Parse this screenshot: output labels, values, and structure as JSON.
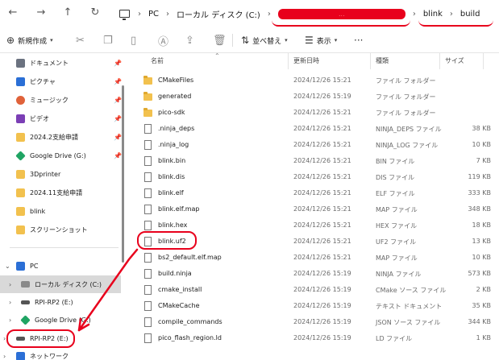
{
  "address_bar": {
    "pc": "PC",
    "drive": "ローカル ディスク (C:)",
    "redacted": "...",
    "blink": "blink",
    "build": "build"
  },
  "toolbar": {
    "new_label": "新規作成",
    "sort_label": "並べ替え",
    "view_label": "表示"
  },
  "sidebar": {
    "quick": [
      {
        "label": "ドキュメント",
        "icon": "document-icon",
        "color": "#6b7280"
      },
      {
        "label": "ピクチャ",
        "icon": "picture-icon",
        "color": "#2b6fd6"
      },
      {
        "label": "ミュージック",
        "icon": "music-icon",
        "color": "#e0623a"
      },
      {
        "label": "ビデオ",
        "icon": "video-icon",
        "color": "#7b3fb5"
      },
      {
        "label": "2024.2支給申請",
        "icon": "folder-icon",
        "color": "#f2c14e"
      },
      {
        "label": "Google Drive (G:)",
        "icon": "google-drive-icon",
        "color": "#1fa463"
      },
      {
        "label": "3Dprinter",
        "icon": "folder-icon",
        "color": "#f2c14e"
      },
      {
        "label": "2024.11支給申請",
        "icon": "folder-icon",
        "color": "#f2c14e"
      },
      {
        "label": "blink",
        "icon": "folder-icon",
        "color": "#f2c14e"
      },
      {
        "label": "スクリーンショット",
        "icon": "folder-icon",
        "color": "#f2c14e"
      }
    ],
    "pc": "PC",
    "drives": [
      {
        "label": "ローカル ディスク (C:)",
        "icon": "windows-drive-icon"
      },
      {
        "label": "RPI-RP2 (E:)",
        "icon": "usb-drive-icon"
      },
      {
        "label": "Google Drive (G:)",
        "icon": "google-drive-icon"
      },
      {
        "label": "RPI-RP2 (E:)",
        "icon": "usb-drive-icon"
      }
    ],
    "network": "ネットワーク"
  },
  "file_list": {
    "columns": {
      "name": "名前",
      "date": "更新日時",
      "type": "種類",
      "size": "サイズ"
    },
    "rows": [
      {
        "name": "CMakeFiles",
        "date": "2024/12/26 15:21",
        "type": "ファイル フォルダー",
        "size": "",
        "kind": "folder"
      },
      {
        "name": "generated",
        "date": "2024/12/26 15:19",
        "type": "ファイル フォルダー",
        "size": "",
        "kind": "folder"
      },
      {
        "name": "pico-sdk",
        "date": "2024/12/26 15:21",
        "type": "ファイル フォルダー",
        "size": "",
        "kind": "folder"
      },
      {
        "name": ".ninja_deps",
        "date": "2024/12/26 15:21",
        "type": "NINJA_DEPS ファイル",
        "size": "38 KB",
        "kind": "file"
      },
      {
        "name": ".ninja_log",
        "date": "2024/12/26 15:21",
        "type": "NINJA_LOG ファイル",
        "size": "10 KB",
        "kind": "file"
      },
      {
        "name": "blink.bin",
        "date": "2024/12/26 15:21",
        "type": "BIN ファイル",
        "size": "7 KB",
        "kind": "file"
      },
      {
        "name": "blink.dis",
        "date": "2024/12/26 15:21",
        "type": "DIS ファイル",
        "size": "119 KB",
        "kind": "file"
      },
      {
        "name": "blink.elf",
        "date": "2024/12/26 15:21",
        "type": "ELF ファイル",
        "size": "333 KB",
        "kind": "file"
      },
      {
        "name": "blink.elf.map",
        "date": "2024/12/26 15:21",
        "type": "MAP ファイル",
        "size": "348 KB",
        "kind": "file"
      },
      {
        "name": "blink.hex",
        "date": "2024/12/26 15:21",
        "type": "HEX ファイル",
        "size": "18 KB",
        "kind": "file"
      },
      {
        "name": "blink.uf2",
        "date": "2024/12/26 15:21",
        "type": "UF2 ファイル",
        "size": "13 KB",
        "kind": "file"
      },
      {
        "name": "bs2_default.elf.map",
        "date": "2024/12/26 15:21",
        "type": "MAP ファイル",
        "size": "10 KB",
        "kind": "file"
      },
      {
        "name": "build.ninja",
        "date": "2024/12/26 15:19",
        "type": "NINJA ファイル",
        "size": "573 KB",
        "kind": "file"
      },
      {
        "name": "cmake_install",
        "date": "2024/12/26 15:19",
        "type": "CMake ソース ファイル",
        "size": "2 KB",
        "kind": "file"
      },
      {
        "name": "CMakeCache",
        "date": "2024/12/26 15:19",
        "type": "テキスト ドキュメント",
        "size": "35 KB",
        "kind": "file"
      },
      {
        "name": "compile_commands",
        "date": "2024/12/26 15:19",
        "type": "JSON ソース ファイル",
        "size": "344 KB",
        "kind": "file"
      },
      {
        "name": "pico_flash_region.ld",
        "date": "2024/12/26 15:19",
        "type": "LD ファイル",
        "size": "1 KB",
        "kind": "file"
      }
    ]
  },
  "colors": {
    "annotation": "#e8001c",
    "selected": "#d9d9d9",
    "folder": "#f2c14e"
  }
}
